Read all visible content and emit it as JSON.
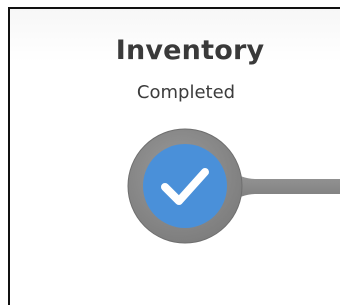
{
  "step": {
    "title": "Inventory",
    "status": "Completed",
    "icon": "checkmark-icon",
    "state": "completed"
  },
  "colors": {
    "node_fill": "#4a90d9",
    "node_ring": "#8a8a8a",
    "connector": "#8a8a8a",
    "check": "#ffffff",
    "title_text": "#3a3a3a",
    "status_text": "#3c3c3c"
  }
}
